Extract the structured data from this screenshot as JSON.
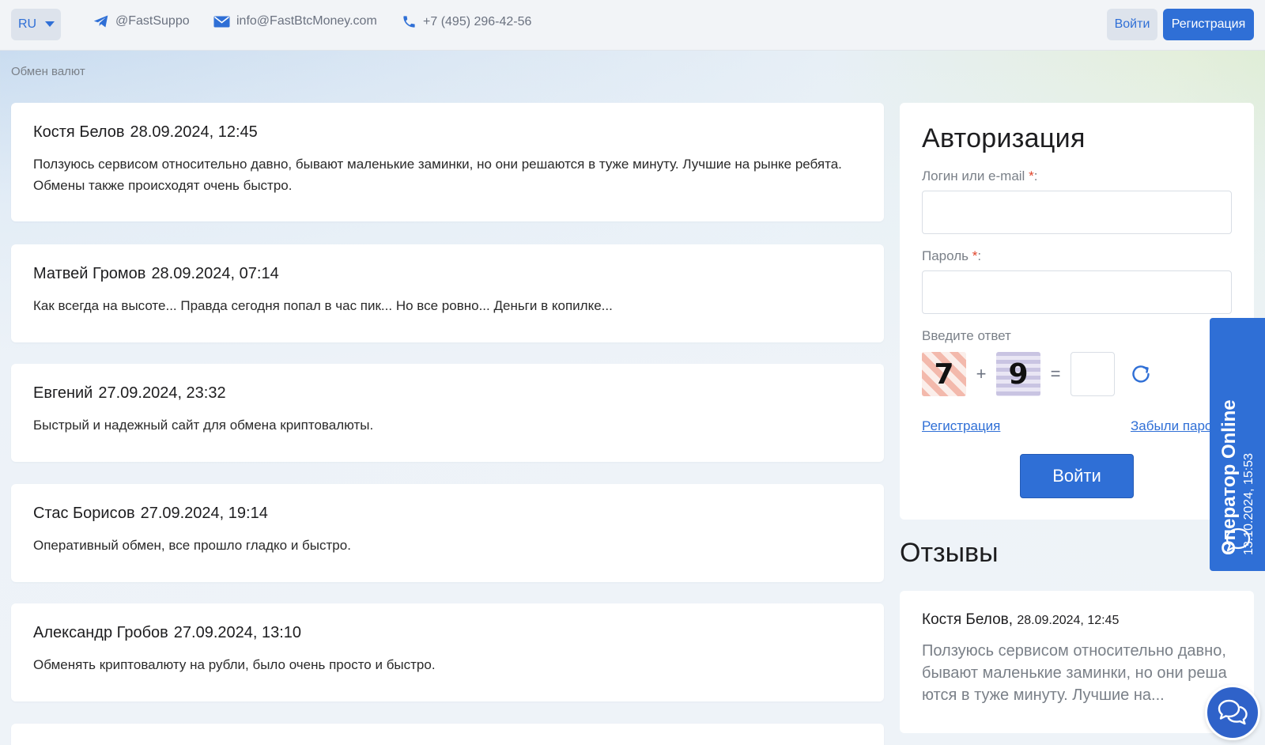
{
  "header": {
    "lang": "RU",
    "telegram": "@FastSuppo",
    "email": "info@FastBtcMoney.com",
    "phone": "+7 (495) 296-42-56",
    "login_label": "Войти",
    "register_label": "Регистрация"
  },
  "breadcrumb": "Обмен валют",
  "reviews": [
    {
      "name": "Костя Белов",
      "date": "28.09.2024, 12:45",
      "text": "Ползуюсь сервисом относительно давно, бывают маленькие заминки, но они решаются в туже минуту. Лучшие на рынке ребята. Обмены также происходят очень быстро."
    },
    {
      "name": "Матвей Громов",
      "date": "28.09.2024, 07:14",
      "text": "Как всегда на высоте... Правда сегодня попал в час пик... Но все ровно... Деньги в копилке..."
    },
    {
      "name": "Евгений",
      "date": "27.09.2024, 23:32",
      "text": "Быстрый и надежный сайт для обмена криптовалюты."
    },
    {
      "name": "Стас Борисов",
      "date": "27.09.2024, 19:14",
      "text": "Оперативный обмен, все прошло гладко и быстро."
    },
    {
      "name": "Александр Гробов",
      "date": "27.09.2024, 13:10",
      "text": "Обменять криптовалюту на рубли, было очень просто и быстро."
    }
  ],
  "auth": {
    "title": "Авторизация",
    "login_label": "Логин или e-mail",
    "password_label": "Пароль",
    "required_mark": "*",
    "label_suffix": ":",
    "captcha_label": "Введите ответ",
    "captcha_a": "7",
    "captcha_op": "+",
    "captcha_b": "9",
    "captcha_eq": "=",
    "register_link": "Регистрация",
    "forgot_link": "Забыли пароль?",
    "submit_label": "Войти"
  },
  "side_reviews": {
    "title": "Отзывы",
    "name": "Костя Белов,",
    "date": "28.09.2024, 12:45",
    "text": "Ползуюсь сервисом относительно давно, бывают маленькие заминки, но они решаются в туже минуту. Лучшие на..."
  },
  "operator": {
    "title": "Оператор Online",
    "date": "13.10.2024, 15:53"
  },
  "colors": {
    "accent": "#2f6fd6",
    "required": "#e0452b"
  }
}
